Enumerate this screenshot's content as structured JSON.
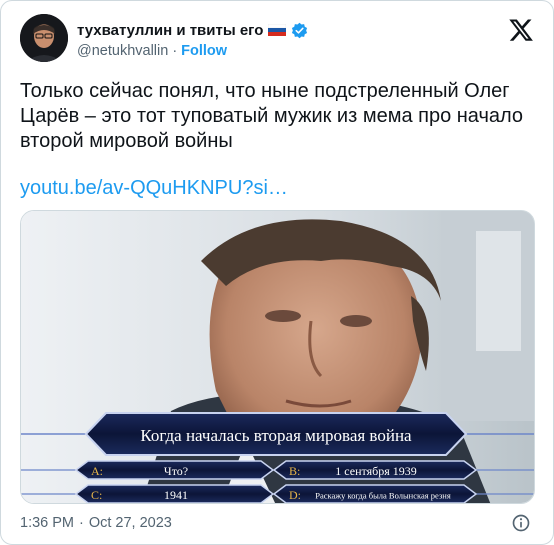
{
  "author": {
    "name": "тухватуллин и твиты его",
    "flag": "russian-flag-icon",
    "verified": true,
    "handle": "@netukhvallin",
    "separator": "·",
    "follow_label": "Follow"
  },
  "tweet": {
    "text": "Только сейчас понял, что ныне подстреленный Олег Царёв – это тот туповатый мужик из мема про начало второй мировой войны",
    "link": "youtu.be/av-QQuHKNPU?si…"
  },
  "media": {
    "question": "Когда началась вторая мировая война",
    "answers": [
      {
        "letter": "A:",
        "text": "Что?"
      },
      {
        "letter": "B:",
        "text": "1 сентября 1939"
      },
      {
        "letter": "C:",
        "text": "1941"
      },
      {
        "letter": "D:",
        "text": "Раскажу когда была Волынская резня"
      }
    ]
  },
  "meta": {
    "time": "1:36 PM",
    "separator": "·",
    "date": "Oct 27, 2023"
  },
  "colors": {
    "link": "#1d9bf0",
    "secondary_text": "#536471",
    "quiz_gold": "#e8b64a"
  }
}
